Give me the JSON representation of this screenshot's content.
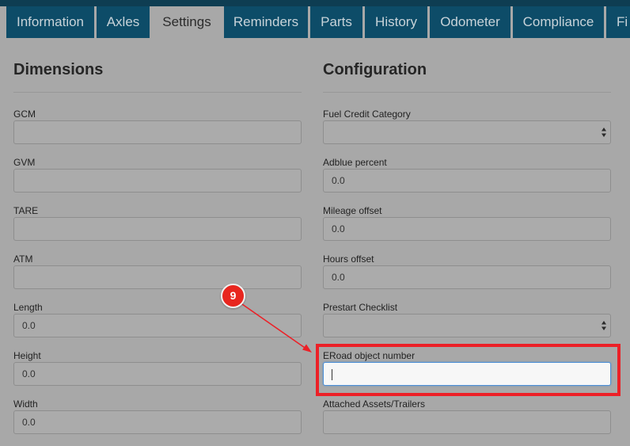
{
  "tabs": [
    {
      "label": "Information",
      "active": false
    },
    {
      "label": "Axles",
      "active": false
    },
    {
      "label": "Settings",
      "active": true
    },
    {
      "label": "Reminders",
      "active": false
    },
    {
      "label": "Parts",
      "active": false
    },
    {
      "label": "History",
      "active": false
    },
    {
      "label": "Odometer",
      "active": false
    },
    {
      "label": "Compliance",
      "active": false
    },
    {
      "label": "Fi",
      "active": false
    }
  ],
  "dimensions": {
    "title": "Dimensions",
    "fields": [
      {
        "label": "GCM",
        "value": ""
      },
      {
        "label": "GVM",
        "value": ""
      },
      {
        "label": "TARE",
        "value": ""
      },
      {
        "label": "ATM",
        "value": ""
      },
      {
        "label": "Length",
        "value": "0.0"
      },
      {
        "label": "Height",
        "value": "0.0"
      },
      {
        "label": "Width",
        "value": "0.0"
      }
    ]
  },
  "configuration": {
    "title": "Configuration",
    "fields": [
      {
        "label": "Fuel Credit Category",
        "value": "",
        "type": "select"
      },
      {
        "label": "Adblue percent",
        "value": "0.0",
        "type": "text"
      },
      {
        "label": "Mileage offset",
        "value": "0.0",
        "type": "text"
      },
      {
        "label": "Hours offset",
        "value": "0.0",
        "type": "text"
      },
      {
        "label": "Prestart Checklist",
        "value": "",
        "type": "select"
      },
      {
        "label": "ERoad object number",
        "value": "",
        "type": "text",
        "focused": true
      },
      {
        "label": "Attached Assets/Trailers",
        "value": "",
        "type": "text"
      }
    ]
  },
  "annotation": {
    "step_number": "9",
    "color": "#e8261f"
  }
}
